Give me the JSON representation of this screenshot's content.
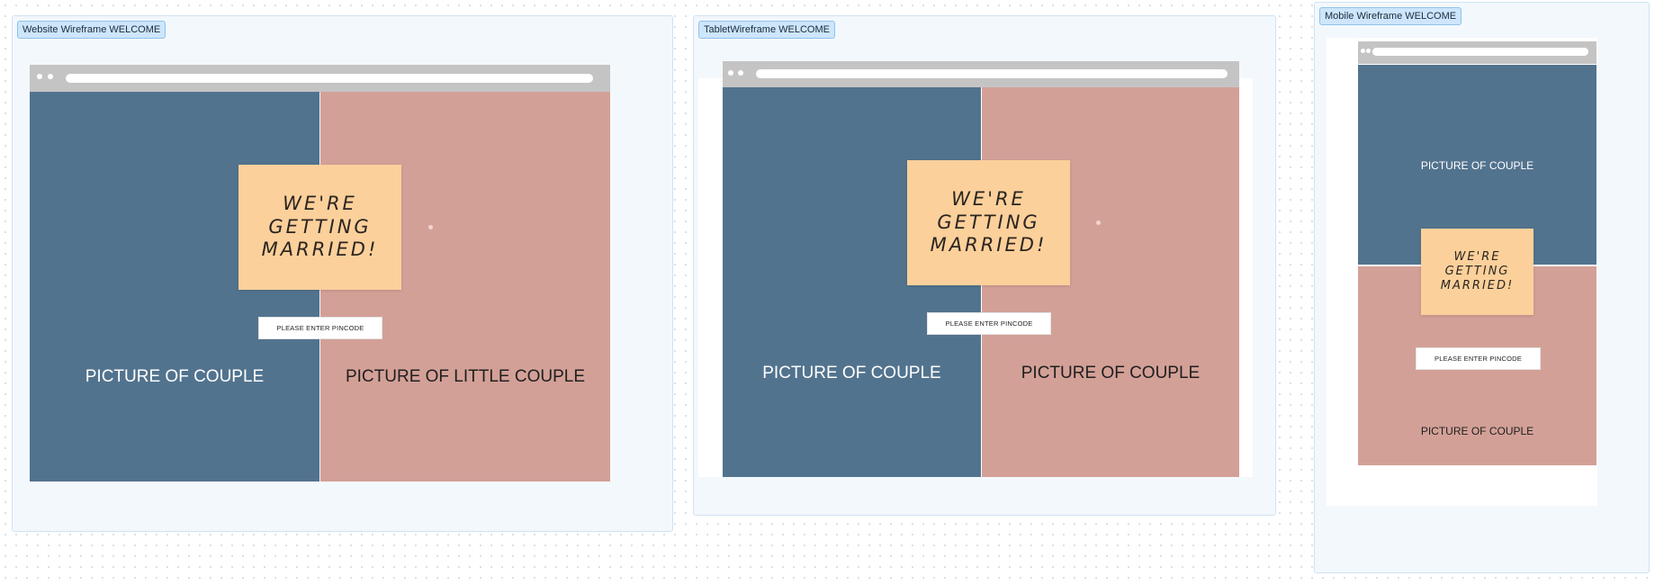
{
  "frames": {
    "website": {
      "label": "Website Wireframe WELCOME",
      "left_picture": "PICTURE OF COUPLE",
      "right_picture": "PICTURE OF LITTLE COUPLE",
      "sticky_note": "WE'RE\nGETTING\nMARRIED!",
      "pincode_button": "PLEASE ENTER PINCODE"
    },
    "tablet": {
      "label": "TabletWireframe WELCOME",
      "left_picture": "PICTURE OF COUPLE",
      "right_picture": "PICTURE OF COUPLE",
      "sticky_note": "WE'RE\nGETTING\nMARRIED!",
      "pincode_button": "PLEASE ENTER PINCODE"
    },
    "mobile": {
      "label": "Mobile Wireframe WELCOME",
      "top_picture": "PICTURE OF COUPLE",
      "bottom_picture": "PICTURE OF COUPLE",
      "sticky_note": "WE'RE\nGETTING\nMARRIED!",
      "pincode_button": "PLEASE ENTER PINCODE"
    }
  },
  "colors": {
    "frame_background": "#f3f8fd",
    "label_background": "#cde6fb",
    "picture_blue": "#52738e",
    "picture_pink": "#d3a097",
    "sticky_note": "#fbd09b",
    "browser_bar": "#c4c4c4"
  },
  "icons": [
    "window-dot-icon",
    "address-bar"
  ]
}
